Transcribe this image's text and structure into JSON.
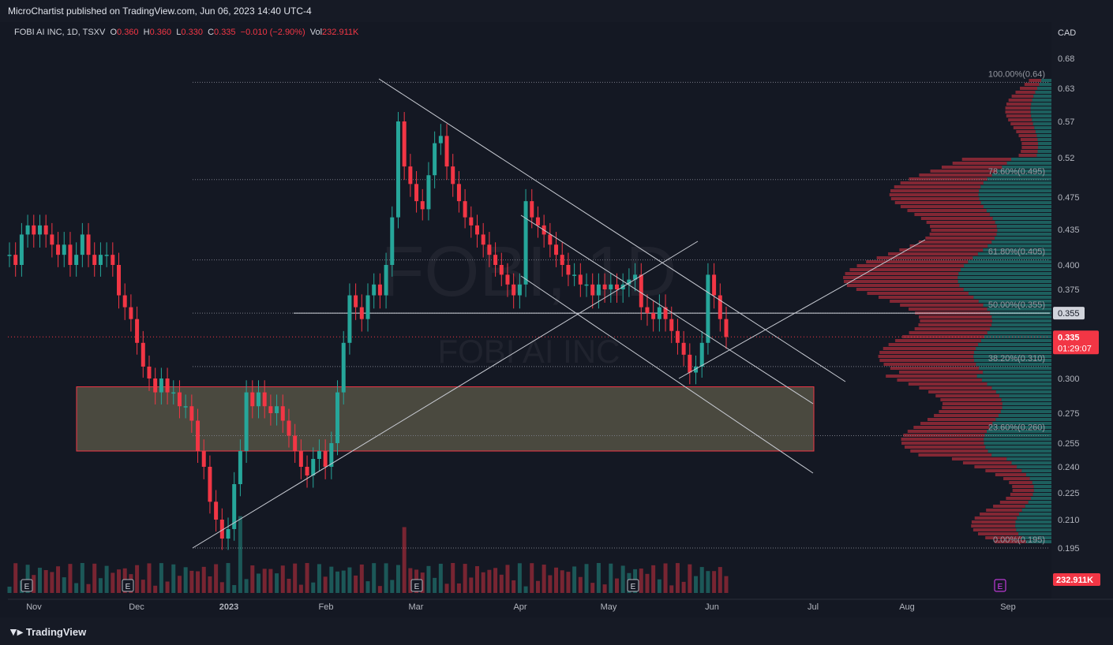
{
  "header": {
    "publish_line": "MicroChartist published on TradingView.com, Jun 06, 2023 14:40 UTC-4"
  },
  "legend": {
    "symbol": "FOBI AI INC, 1D, TSXV",
    "o_label": "O",
    "o_value": "0.360",
    "h_label": "H",
    "h_value": "0.360",
    "l_label": "L",
    "l_value": "0.330",
    "c_label": "C",
    "c_value": "0.335",
    "change": "−0.010 (−2.90%)",
    "vol_label": "Vol",
    "vol_value": "232.911K"
  },
  "footer": {
    "brand": "TradingView"
  },
  "watermark": {
    "ticker": "FOBI, 1D",
    "name": "FOBI AI INC"
  },
  "colors": {
    "up": "#26a69a",
    "down": "#f23645",
    "background": "#141823",
    "zone_fill": "#7f7a5c",
    "zone_border": "#f23645",
    "trendline": "#c9ccd4"
  },
  "chart_data": {
    "type": "candlestick",
    "currency": "CAD",
    "y_ticks": [
      0.68,
      0.63,
      0.57,
      0.52,
      0.475,
      0.435,
      0.4,
      0.375,
      0.3,
      0.275,
      0.255,
      0.24,
      0.225,
      0.21,
      0.195
    ],
    "y_tick_labels": [
      "0.68",
      "0.63",
      "0.57",
      "0.52",
      "0.475",
      "0.435",
      "0.400",
      "0.375",
      "0.300",
      "0.275",
      "0.255",
      "0.240",
      "0.225",
      "0.210",
      "0.195"
    ],
    "x_tick_labels": [
      "Nov",
      "Dec",
      "2023",
      "Feb",
      "Mar",
      "Apr",
      "May",
      "Jun",
      "Jul",
      "Aug",
      "Sep"
    ],
    "price_labels": [
      {
        "value": 0.355,
        "text": "0.355",
        "style": "line"
      },
      {
        "value": 0.335,
        "text": "0.335",
        "countdown": "01:29:07",
        "style": "last"
      }
    ],
    "volume_label": "232.911K",
    "fibonacci": [
      {
        "level": "100.00%",
        "price": 0.64,
        "text": "100.00%(0.64)"
      },
      {
        "level": "78.60%",
        "price": 0.495,
        "text": "78.60%(0.495)"
      },
      {
        "level": "61.80%",
        "price": 0.405,
        "text": "61.80%(0.405)"
      },
      {
        "level": "50.00%",
        "price": 0.355,
        "text": "50.00%(0.355)"
      },
      {
        "level": "38.20%",
        "price": 0.31,
        "text": "38.20%(0.310)"
      },
      {
        "level": "23.60%",
        "price": 0.26,
        "text": "23.60%(0.260)"
      },
      {
        "level": "0.00%",
        "price": 0.195,
        "text": "0.00%(0.195)"
      }
    ],
    "zone": {
      "low": 0.25,
      "high": 0.294
    },
    "event_markers": [
      "E",
      "E",
      "E",
      "E",
      "E"
    ],
    "close_series": [
      0.41,
      0.4,
      0.43,
      0.44,
      0.43,
      0.44,
      0.43,
      0.42,
      0.41,
      0.42,
      0.4,
      0.41,
      0.43,
      0.41,
      0.4,
      0.41,
      0.41,
      0.4,
      0.37,
      0.36,
      0.35,
      0.33,
      0.31,
      0.3,
      0.29,
      0.3,
      0.29,
      0.29,
      0.28,
      0.28,
      0.27,
      0.25,
      0.24,
      0.22,
      0.21,
      0.2,
      0.205,
      0.23,
      0.25,
      0.29,
      0.28,
      0.29,
      0.28,
      0.275,
      0.28,
      0.27,
      0.26,
      0.25,
      0.24,
      0.235,
      0.245,
      0.25,
      0.24,
      0.255,
      0.29,
      0.33,
      0.37,
      0.36,
      0.35,
      0.37,
      0.38,
      0.37,
      0.4,
      0.45,
      0.57,
      0.51,
      0.49,
      0.47,
      0.46,
      0.5,
      0.54,
      0.55,
      0.51,
      0.49,
      0.47,
      0.45,
      0.44,
      0.43,
      0.42,
      0.41,
      0.4,
      0.39,
      0.38,
      0.37,
      0.38,
      0.47,
      0.45,
      0.44,
      0.43,
      0.42,
      0.41,
      0.4,
      0.39,
      0.39,
      0.38,
      0.38,
      0.37,
      0.38,
      0.375,
      0.38,
      0.375,
      0.38,
      0.385,
      0.39,
      0.36,
      0.355,
      0.35,
      0.36,
      0.35,
      0.34,
      0.33,
      0.32,
      0.305,
      0.31,
      0.33,
      0.39,
      0.37,
      0.35,
      0.335
    ]
  }
}
